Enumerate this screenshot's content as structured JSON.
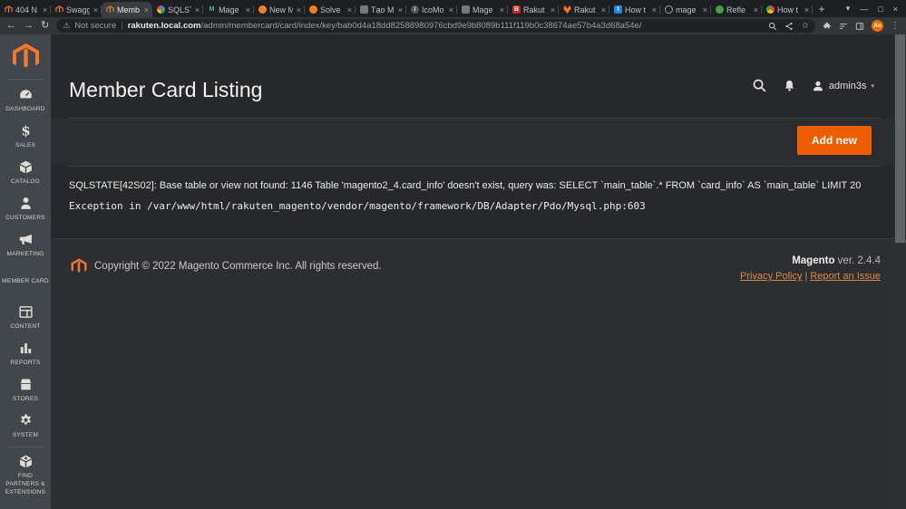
{
  "browser": {
    "tabs": [
      {
        "label": "404 N",
        "icon": "magento",
        "active": false
      },
      {
        "label": "Swagg",
        "icon": "magento",
        "active": false
      },
      {
        "label": "Memb",
        "icon": "magento",
        "active": true
      },
      {
        "label": "SQLST",
        "icon": "google",
        "active": false
      },
      {
        "label": "Mage",
        "icon": "m-teal",
        "active": false
      },
      {
        "label": "New M",
        "icon": "stackexchange",
        "active": false
      },
      {
        "label": "Solve",
        "icon": "stackexchange",
        "active": false
      },
      {
        "label": "Tạo M",
        "icon": "grey-doc",
        "active": false
      },
      {
        "label": "IcoMo",
        "icon": "icomoon",
        "active": false
      },
      {
        "label": "Mage",
        "icon": "grey-doc",
        "active": false
      },
      {
        "label": "Rakut",
        "icon": "red-b",
        "active": false
      },
      {
        "label": "Rakut",
        "icon": "gitlab",
        "active": false
      },
      {
        "label": "How t",
        "icon": "blue-t",
        "active": false
      },
      {
        "label": "mage",
        "icon": "globe",
        "active": false
      },
      {
        "label": "Refle",
        "icon": "green",
        "active": false
      },
      {
        "label": "How t",
        "icon": "chrome-colors",
        "active": false
      }
    ],
    "favicon_glyphs": {
      "m-teal": "M",
      "red-b": "B",
      "blue-t": "t",
      "icomoon": "i"
    },
    "security_label": "Not secure",
    "url_domain": "rakuten.local.com",
    "url_path": "/admin/membercard/card/index/key/bab0d4a18dd82588980976cbd9e9b8089b111f119b0c38674ae57b4a3d68a54e/",
    "profile_initials": "An",
    "icons": {
      "back": "←",
      "forward": "→",
      "reload": "↻",
      "warning": "⚠",
      "bookmark_star": "☆",
      "kebab_menu": "⋮",
      "tab_search_caret": "▾",
      "minimize": "—",
      "maximize": "□",
      "close_window": "×",
      "tab_close": "×",
      "new_tab": "+",
      "url_divider": "|"
    }
  },
  "sidebar": {
    "items": [
      {
        "id": "dashboard",
        "label": "DASHBOARD",
        "icon": "dashboard"
      },
      {
        "id": "sales",
        "label": "SALES",
        "icon": "sales"
      },
      {
        "id": "catalog",
        "label": "CATALOG",
        "icon": "catalog"
      },
      {
        "id": "customers",
        "label": "CUSTOMERS",
        "icon": "customers"
      },
      {
        "id": "marketing",
        "label": "MARKETING",
        "icon": "marketing"
      },
      {
        "id": "member-card",
        "label": "MEMBER CARD",
        "icon": null
      },
      {
        "id": "content",
        "label": "CONTENT",
        "icon": "content"
      },
      {
        "id": "reports",
        "label": "REPORTS",
        "icon": "reports"
      },
      {
        "id": "stores",
        "label": "STORES",
        "icon": "stores"
      },
      {
        "id": "system",
        "label": "SYSTEM",
        "icon": "system"
      },
      {
        "id": "find-partners",
        "label": "FIND PARTNERS & EXTENSIONS",
        "icon": "find-partners",
        "divider_before": true
      }
    ]
  },
  "header": {
    "title": "Member Card Listing",
    "username": "admin3s",
    "user_caret": "▾"
  },
  "toolbar": {
    "add_new_label": "Add new"
  },
  "errors": {
    "sql_error": "SQLSTATE[42S02]: Base table or view not found: 1146 Table 'magento2_4.card_info' doesn't exist, query was: SELECT `main_table`.* FROM `card_info` AS `main_table` LIMIT 20",
    "exception": "Exception in /var/www/html/rakuten_magento/vendor/magento/framework/DB/Adapter/Pdo/Mysql.php:603"
  },
  "footer": {
    "copyright": "Copyright © 2022 Magento Commerce Inc. All rights reserved.",
    "version_label": "Magento",
    "version_text": " ver. 2.4.4",
    "privacy_link": "Privacy Policy",
    "link_separator": "|",
    "report_link": "Report an Issue"
  },
  "colors": {
    "accent_orange": "#ed5e02",
    "logo_orange": "#f3782b",
    "link_orange": "#de8a3e",
    "sidebar_bg": "#41474d",
    "content_bg": "#26282b",
    "footer_bg": "#2c2e31"
  }
}
